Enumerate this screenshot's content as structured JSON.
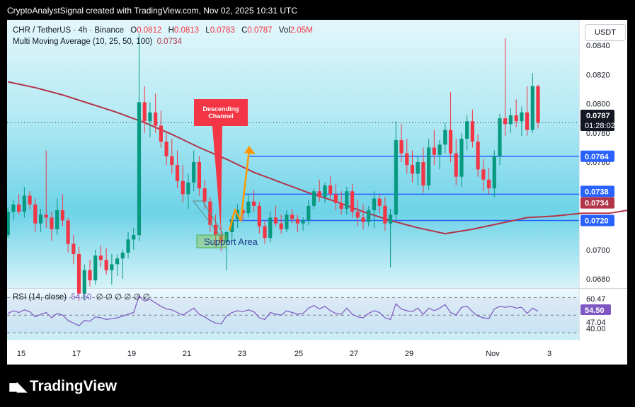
{
  "header_text": "CryptoAnalystSignal created with TradingView.com, Nov 02, 2025 10:31 UTC",
  "legend": {
    "symbol": "CHR / TetherUS · 4h · Binance",
    "o_label": "O",
    "o": "0.0812",
    "h_label": "H",
    "h": "0.0813",
    "l_label": "L",
    "l": "0.0783",
    "c_label": "C",
    "c": "0.0787",
    "vol_label": "Vol",
    "vol": "2.05M",
    "ma_label": "Multi Moving Average (10, 25, 50, 100)",
    "ma_value": "0.0734"
  },
  "currency_button": "USDT",
  "countdown": "01:28:02",
  "annotations": {
    "descending_channel": [
      "Descending",
      "Channel"
    ],
    "support_area": "Support Area"
  },
  "rsi_legend": {
    "label": "RSI (14, close)",
    "value": "54.50",
    "extras": "∅ ∅ ∅ ∅ ∅ ∅"
  },
  "brand": "TradingView",
  "colors": {
    "up": "#089981",
    "down": "#f23645",
    "ma": "#b2354a",
    "level_line": "#2962ff",
    "rsi": "#7e57c2",
    "arrow": "#ff9800",
    "annotation_bg": "#f23645",
    "plot_bg_top": "#e3f7fb",
    "plot_bg_mid": "#6ed3e8"
  },
  "chart_data": {
    "type": "candlestick",
    "pair": "CHR/USDT",
    "timeframe": "4h",
    "exchange": "Binance",
    "x_tick_labels": [
      "15",
      "17",
      "19",
      "21",
      "23",
      "25",
      "27",
      "29",
      "Nov",
      "3"
    ],
    "y_tick_labels": [
      "0.0840",
      "0.0820",
      "0.0800",
      "0.0780",
      "0.0760",
      "0.0740",
      "0.0720",
      "0.0700",
      "0.0680"
    ],
    "ylim": [
      0.0665,
      0.0848
    ],
    "current_price": "0.0787",
    "price_labels": [
      {
        "value": "0.0764",
        "kind": "level"
      },
      {
        "value": "0.0738",
        "kind": "level"
      },
      {
        "value": "0.0734",
        "kind": "ma"
      },
      {
        "value": "0.0720",
        "kind": "level"
      }
    ],
    "horizontal_levels": [
      0.0764,
      0.0738,
      0.072
    ],
    "moving_average": {
      "name": "MA",
      "points": [
        [
          0,
          0.0815
        ],
        [
          5,
          0.0811
        ],
        [
          10,
          0.0806
        ],
        [
          15,
          0.08
        ],
        [
          20,
          0.0794
        ],
        [
          25,
          0.0787
        ],
        [
          30,
          0.0779
        ],
        [
          35,
          0.077
        ],
        [
          40,
          0.0762
        ],
        [
          45,
          0.0753
        ],
        [
          50,
          0.0746
        ],
        [
          55,
          0.0739
        ],
        [
          60,
          0.0733
        ],
        [
          65,
          0.0726
        ],
        [
          70,
          0.072
        ],
        [
          75,
          0.0715
        ],
        [
          80,
          0.0711
        ],
        [
          85,
          0.0714
        ],
        [
          90,
          0.0718
        ],
        [
          95,
          0.0722
        ],
        [
          100,
          0.0723
        ],
        [
          105,
          0.0725
        ],
        [
          110,
          0.0725
        ],
        [
          115,
          0.0728
        ],
        [
          120,
          0.073
        ],
        [
          125,
          0.0734
        ]
      ]
    },
    "candles": [
      [
        0.071,
        0.0729,
        0.0708,
        0.0726
      ],
      [
        0.0726,
        0.0734,
        0.072,
        0.0731
      ],
      [
        0.0731,
        0.0738,
        0.0724,
        0.0726
      ],
      [
        0.0726,
        0.0743,
        0.0722,
        0.0737
      ],
      [
        0.0737,
        0.074,
        0.0728,
        0.0731
      ],
      [
        0.0731,
        0.0735,
        0.0712,
        0.0718
      ],
      [
        0.0718,
        0.0728,
        0.0712,
        0.0724
      ],
      [
        0.0724,
        0.0768,
        0.0715,
        0.0722
      ],
      [
        0.0722,
        0.0726,
        0.0706,
        0.0714
      ],
      [
        0.0714,
        0.0735,
        0.071,
        0.0727
      ],
      [
        0.0727,
        0.0738,
        0.0716,
        0.072
      ],
      [
        0.072,
        0.0722,
        0.0698,
        0.0704
      ],
      [
        0.0704,
        0.071,
        0.069,
        0.0697
      ],
      [
        0.0697,
        0.0702,
        0.0665,
        0.067
      ],
      [
        0.067,
        0.069,
        0.0665,
        0.0686
      ],
      [
        0.0686,
        0.0693,
        0.0675,
        0.0679
      ],
      [
        0.0679,
        0.07,
        0.0676,
        0.0696
      ],
      [
        0.0696,
        0.0703,
        0.0688,
        0.0693
      ],
      [
        0.0693,
        0.0701,
        0.0683,
        0.0686
      ],
      [
        0.0686,
        0.0697,
        0.0676,
        0.069
      ],
      [
        0.069,
        0.0697,
        0.0682,
        0.0694
      ],
      [
        0.0694,
        0.07,
        0.068,
        0.0698
      ],
      [
        0.0698,
        0.0712,
        0.0694,
        0.0707
      ],
      [
        0.0707,
        0.0715,
        0.07,
        0.071
      ],
      [
        0.071,
        0.0848,
        0.0706,
        0.0801
      ],
      [
        0.0801,
        0.0812,
        0.078,
        0.0788
      ],
      [
        0.0788,
        0.0801,
        0.0777,
        0.0794
      ],
      [
        0.0794,
        0.0807,
        0.078,
        0.0785
      ],
      [
        0.0785,
        0.0795,
        0.077,
        0.0774
      ],
      [
        0.0774,
        0.0781,
        0.0758,
        0.0764
      ],
      [
        0.0764,
        0.0776,
        0.0752,
        0.0758
      ],
      [
        0.0758,
        0.0768,
        0.0742,
        0.0747
      ],
      [
        0.0747,
        0.0758,
        0.0732,
        0.0738
      ],
      [
        0.0738,
        0.0752,
        0.0728,
        0.0746
      ],
      [
        0.0746,
        0.0768,
        0.074,
        0.076
      ],
      [
        0.076,
        0.0764,
        0.0737,
        0.0742
      ],
      [
        0.0742,
        0.0748,
        0.0728,
        0.0733
      ],
      [
        0.0733,
        0.0736,
        0.0712,
        0.0717
      ],
      [
        0.0717,
        0.0724,
        0.0703,
        0.071
      ],
      [
        0.071,
        0.0716,
        0.0699,
        0.0705
      ],
      [
        0.0705,
        0.0713,
        0.0686,
        0.0712
      ],
      [
        0.0712,
        0.0723,
        0.0706,
        0.0721
      ],
      [
        0.0721,
        0.0731,
        0.0715,
        0.0727
      ],
      [
        0.0727,
        0.0734,
        0.072,
        0.0725
      ],
      [
        0.0725,
        0.0738,
        0.0722,
        0.0733
      ],
      [
        0.0733,
        0.0741,
        0.0726,
        0.073
      ],
      [
        0.073,
        0.0733,
        0.0711,
        0.0716
      ],
      [
        0.0716,
        0.072,
        0.0704,
        0.0708
      ],
      [
        0.0708,
        0.0726,
        0.0705,
        0.0722
      ],
      [
        0.0722,
        0.073,
        0.0716,
        0.0718
      ],
      [
        0.0718,
        0.0724,
        0.0711,
        0.0714
      ],
      [
        0.0714,
        0.0727,
        0.0712,
        0.0724
      ],
      [
        0.0724,
        0.0728,
        0.0718,
        0.0721
      ],
      [
        0.0721,
        0.0724,
        0.0712,
        0.0718
      ],
      [
        0.0718,
        0.0722,
        0.0713,
        0.072
      ],
      [
        0.072,
        0.0734,
        0.0717,
        0.073
      ],
      [
        0.073,
        0.0742,
        0.0728,
        0.074
      ],
      [
        0.074,
        0.0748,
        0.0733,
        0.0736
      ],
      [
        0.0736,
        0.0746,
        0.0732,
        0.0744
      ],
      [
        0.0744,
        0.075,
        0.0735,
        0.0738
      ],
      [
        0.0738,
        0.0745,
        0.0727,
        0.0732
      ],
      [
        0.0732,
        0.074,
        0.0724,
        0.0728
      ],
      [
        0.0728,
        0.0743,
        0.0724,
        0.074
      ],
      [
        0.074,
        0.0745,
        0.0722,
        0.0726
      ],
      [
        0.0726,
        0.0734,
        0.0716,
        0.0722
      ],
      [
        0.0722,
        0.0731,
        0.0714,
        0.0719
      ],
      [
        0.0719,
        0.073,
        0.0716,
        0.0727
      ],
      [
        0.0727,
        0.074,
        0.0715,
        0.0735
      ],
      [
        0.0735,
        0.0738,
        0.0725,
        0.073
      ],
      [
        0.073,
        0.0736,
        0.0713,
        0.0718
      ],
      [
        0.0718,
        0.0728,
        0.0688,
        0.0724
      ],
      [
        0.0724,
        0.0788,
        0.072,
        0.0775
      ],
      [
        0.0775,
        0.0786,
        0.076,
        0.0766
      ],
      [
        0.0766,
        0.0776,
        0.0752,
        0.0758
      ],
      [
        0.0758,
        0.0768,
        0.0746,
        0.0752
      ],
      [
        0.0752,
        0.0764,
        0.0744,
        0.076
      ],
      [
        0.076,
        0.077,
        0.0739,
        0.0744
      ],
      [
        0.0744,
        0.0776,
        0.0741,
        0.077
      ],
      [
        0.077,
        0.0782,
        0.0758,
        0.0765
      ],
      [
        0.0765,
        0.0775,
        0.0755,
        0.0772
      ],
      [
        0.0772,
        0.0787,
        0.0766,
        0.0782
      ],
      [
        0.0782,
        0.0808,
        0.076,
        0.0766
      ],
      [
        0.0766,
        0.0776,
        0.0744,
        0.075
      ],
      [
        0.075,
        0.078,
        0.0743,
        0.0776
      ],
      [
        0.0776,
        0.0792,
        0.0768,
        0.0788
      ],
      [
        0.0788,
        0.0796,
        0.077,
        0.0774
      ],
      [
        0.0774,
        0.0779,
        0.075,
        0.0755
      ],
      [
        0.0755,
        0.0762,
        0.074,
        0.0748
      ],
      [
        0.0748,
        0.0756,
        0.0738,
        0.0742
      ],
      [
        0.0742,
        0.0768,
        0.0736,
        0.0764
      ],
      [
        0.0764,
        0.0793,
        0.0758,
        0.079
      ],
      [
        0.079,
        0.0845,
        0.0778,
        0.0786
      ],
      [
        0.0786,
        0.0797,
        0.078,
        0.0792
      ],
      [
        0.0792,
        0.0803,
        0.0784,
        0.0788
      ],
      [
        0.0788,
        0.0798,
        0.0778,
        0.0794
      ],
      [
        0.0794,
        0.0812,
        0.0778,
        0.0782
      ],
      [
        0.0782,
        0.0821,
        0.078,
        0.0812
      ],
      [
        0.0812,
        0.0813,
        0.0783,
        0.0787
      ]
    ],
    "rsi": {
      "name": "RSI (14, close)",
      "value": "54.50",
      "y_tick_labels": [
        "60.47",
        "54.50",
        "47.04",
        "40.00"
      ],
      "ylim": [
        22,
        80
      ],
      "values": [
        52,
        55,
        53,
        56,
        54,
        48,
        51,
        53,
        47,
        52,
        50,
        44,
        41,
        38,
        44,
        43,
        48,
        47,
        45,
        46,
        47,
        49,
        51,
        53,
        72,
        66,
        68,
        64,
        60,
        57,
        56,
        53,
        50,
        54,
        58,
        51,
        48,
        44,
        41,
        40,
        49,
        53,
        55,
        54,
        56,
        54,
        47,
        45,
        53,
        51,
        50,
        55,
        53,
        51,
        52,
        58,
        61,
        57,
        60,
        55,
        52,
        51,
        58,
        51,
        48,
        47,
        52,
        55,
        53,
        47,
        45,
        63,
        57,
        55,
        54,
        58,
        51,
        58,
        55,
        58,
        62,
        53,
        50,
        59,
        60,
        54,
        49,
        47,
        46,
        57,
        60,
        59,
        60,
        58,
        59,
        52,
        58,
        54.5
      ]
    }
  }
}
